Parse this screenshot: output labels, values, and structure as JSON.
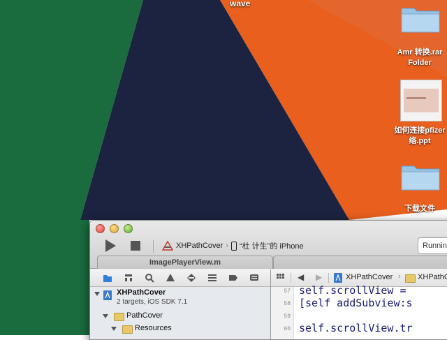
{
  "colors": {
    "orange": "#e85f1e",
    "navy": "#1b2340",
    "green": "#1a6b3e",
    "red": "#b0281e",
    "xcode_bg": "#ececec"
  },
  "desktop": {
    "top_label": "wave",
    "icons": [
      {
        "name": "folder-icon",
        "label_line1": "Amr 转换.rar",
        "label_line2": "Folder"
      },
      {
        "name": "ppt-file-icon",
        "label_line1": "如何连接pfizer",
        "label_line2": "络.ppt"
      },
      {
        "name": "folder-icon",
        "label_line1": "下载文件",
        "label_line2": ""
      }
    ]
  },
  "xcode": {
    "scheme": {
      "project": "XHPathCover",
      "device": "“杜 计生”的 iPhone"
    },
    "status": "Running",
    "tab_title": "ImagePlayerView.m",
    "navigator": {
      "project_name": "XHPathCover",
      "project_sub": "2 targets, iOS SDK 7.1",
      "groups": [
        "PathCover",
        "Resources"
      ]
    },
    "jumpbar": {
      "item1": "XHPathCover",
      "item2": "XHPathC"
    },
    "editor": {
      "lines": [
        {
          "no": "57",
          "code": "self.scrollView ="
        },
        {
          "no": "58",
          "code": "[self addSubview:s"
        },
        {
          "no": "59",
          "code": ""
        },
        {
          "no": "60",
          "code": "self.scrollView.tr"
        }
      ]
    }
  }
}
